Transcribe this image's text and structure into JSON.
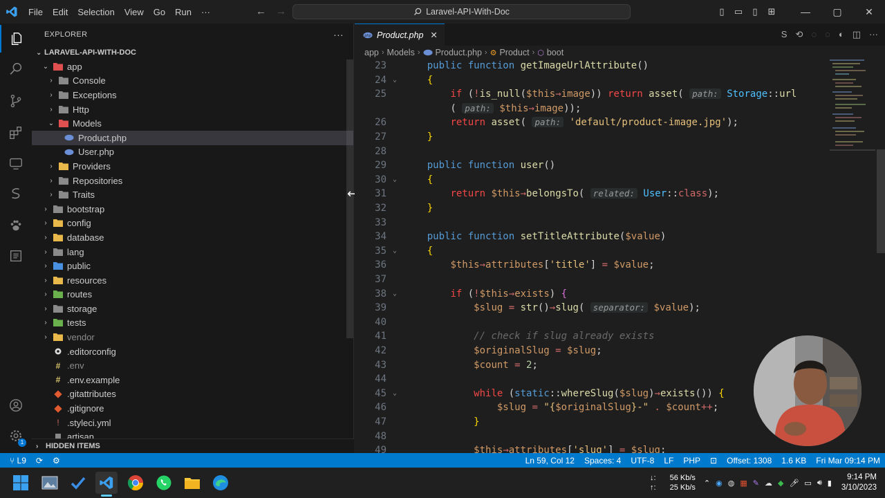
{
  "titlebar": {
    "menu": [
      "File",
      "Edit",
      "Selection",
      "View",
      "Go",
      "Run",
      "···"
    ],
    "search_text": "Laravel-API-With-Doc"
  },
  "sidebar": {
    "title": "EXPLORER",
    "more": "···",
    "project": "LARAVEL-API-WITH-DOC",
    "items": [
      {
        "label": "app",
        "chev": "⌄",
        "indent": 1,
        "icon": "folder-app-icon"
      },
      {
        "label": "Console",
        "chev": "›",
        "indent": 2,
        "icon": "folder-icon"
      },
      {
        "label": "Exceptions",
        "chev": "›",
        "indent": 2,
        "icon": "folder-icon"
      },
      {
        "label": "Http",
        "chev": "›",
        "indent": 2,
        "icon": "folder-icon"
      },
      {
        "label": "Models",
        "chev": "⌄",
        "indent": 2,
        "icon": "folder-models-icon"
      },
      {
        "label": "Product.php",
        "chev": "",
        "indent": 3,
        "icon": "php-file-icon",
        "selected": true
      },
      {
        "label": "User.php",
        "chev": "",
        "indent": 3,
        "icon": "php-file-icon"
      },
      {
        "label": "Providers",
        "chev": "›",
        "indent": 2,
        "icon": "folder-yellow-icon"
      },
      {
        "label": "Repositories",
        "chev": "›",
        "indent": 2,
        "icon": "folder-icon"
      },
      {
        "label": "Traits",
        "chev": "›",
        "indent": 2,
        "icon": "folder-icon"
      },
      {
        "label": "bootstrap",
        "chev": "›",
        "indent": 1,
        "icon": "folder-icon"
      },
      {
        "label": "config",
        "chev": "›",
        "indent": 1,
        "icon": "folder-yellow-icon"
      },
      {
        "label": "database",
        "chev": "›",
        "indent": 1,
        "icon": "folder-yellow-icon"
      },
      {
        "label": "lang",
        "chev": "›",
        "indent": 1,
        "icon": "folder-icon"
      },
      {
        "label": "public",
        "chev": "›",
        "indent": 1,
        "icon": "folder-blue-icon"
      },
      {
        "label": "resources",
        "chev": "›",
        "indent": 1,
        "icon": "folder-yellow-icon"
      },
      {
        "label": "routes",
        "chev": "›",
        "indent": 1,
        "icon": "folder-green-icon"
      },
      {
        "label": "storage",
        "chev": "›",
        "indent": 1,
        "icon": "folder-icon"
      },
      {
        "label": "tests",
        "chev": "›",
        "indent": 1,
        "icon": "folder-green-icon"
      },
      {
        "label": "vendor",
        "chev": "›",
        "indent": 1,
        "icon": "folder-yellow-icon",
        "dim": true
      },
      {
        "label": ".editorconfig",
        "chev": "",
        "indent": 1,
        "icon": "gear-file-icon"
      },
      {
        "label": ".env",
        "chev": "",
        "indent": 1,
        "icon": "hash-file-icon",
        "dim": true
      },
      {
        "label": ".env.example",
        "chev": "",
        "indent": 1,
        "icon": "hash-file-icon"
      },
      {
        "label": ".gitattributes",
        "chev": "",
        "indent": 1,
        "icon": "git-file-icon"
      },
      {
        "label": ".gitignore",
        "chev": "",
        "indent": 1,
        "icon": "git-file-icon"
      },
      {
        "label": ".styleci.yml",
        "chev": "",
        "indent": 1,
        "icon": "yml-file-icon"
      },
      {
        "label": "artisan",
        "chev": "",
        "indent": 1,
        "icon": "file-icon"
      }
    ],
    "hidden_items": "HIDDEN ITEMS"
  },
  "editor": {
    "tab_label": "Product.php",
    "breadcrumb": [
      "app",
      "Models",
      "Product.php",
      "Product",
      "boot"
    ]
  },
  "code_lines": [
    {
      "n": "23",
      "html": "<span class='k'>public</span> <span class='k'>function</span> <span class='fy'>getImageUrlAttribute</span>()"
    },
    {
      "n": "24",
      "html": "<span class='br1'>{</span>",
      "fold": true
    },
    {
      "n": "25",
      "html": "    <span class='kr'>if</span> (<span class='op'>!</span><span class='fy'>is_null</span>(<span class='v'>$this</span><span class='op'>→</span><span class='v'>image</span>)) <span class='kr'>return</span> <span class='fy'>asset</span>( <span class='hint'>path:</span> <span class='cls'>Storage</span>::<span class='fy'>url</span>"
    },
    {
      "n": "",
      "html": "    ( <span class='hint'>path:</span> <span class='v'>$this</span><span class='op'>→</span><span class='v'>image</span>));"
    },
    {
      "n": "26",
      "html": "    <span class='kr'>return</span> <span class='fy'>asset</span>( <span class='hint'>path:</span> <span class='st'>'default/product-image.jpg'</span>);"
    },
    {
      "n": "27",
      "html": "<span class='br1'>}</span>"
    },
    {
      "n": "28",
      "html": ""
    },
    {
      "n": "29",
      "html": "<span class='k'>public</span> <span class='k'>function</span> <span class='fy'>user</span>()"
    },
    {
      "n": "30",
      "html": "<span class='br1'>{</span>",
      "fold": true
    },
    {
      "n": "31",
      "html": "    <span class='kr'>return</span> <span class='v'>$this</span><span class='op'>→</span><span class='fy'>belongsTo</span>( <span class='hint'>related:</span> <span class='cls'>User</span>::<span class='op'>class</span>);"
    },
    {
      "n": "32",
      "html": "<span class='br1'>}</span>"
    },
    {
      "n": "33",
      "html": ""
    },
    {
      "n": "34",
      "html": "<span class='k'>public</span> <span class='k'>function</span> <span class='fy'>setTitleAttribute</span>(<span class='v'>$value</span>)"
    },
    {
      "n": "35",
      "html": "<span class='br1'>{</span>",
      "fold": true
    },
    {
      "n": "36",
      "html": "    <span class='v'>$this</span><span class='op'>→</span><span class='v'>attributes</span>[<span class='st'>'title'</span>] <span class='op'>=</span> <span class='v'>$value</span>;"
    },
    {
      "n": "37",
      "html": ""
    },
    {
      "n": "38",
      "html": "    <span class='kr'>if</span> (<span class='op'>!</span><span class='v'>$this</span><span class='op'>→</span><span class='v'>exists</span>) <span class='br2'>{</span>",
      "fold": true
    },
    {
      "n": "39",
      "html": "        <span class='v'>$slug</span> <span class='op'>=</span> <span class='fy'>str</span>()<span class='op'>→</span><span class='fy'>slug</span>( <span class='hint'>separator:</span> <span class='v'>$value</span>);"
    },
    {
      "n": "40",
      "html": ""
    },
    {
      "n": "41",
      "html": "        <span class='cm'>// check if slug already exists</span>"
    },
    {
      "n": "42",
      "html": "        <span class='v'>$originalSlug</span> <span class='op'>=</span> <span class='v'>$slug</span>;"
    },
    {
      "n": "43",
      "html": "        <span class='v'>$count</span> <span class='op'>=</span> <span class='num'>2</span>;"
    },
    {
      "n": "44",
      "html": ""
    },
    {
      "n": "45",
      "html": "        <span class='kr'>while</span> (<span class='k'>static</span>::<span class='fy'>whereSlug</span>(<span class='v'>$slug</span>)<span class='op'>→</span><span class='fy'>exists</span>()) <span class='br1'>{</span>",
      "fold": true
    },
    {
      "n": "46",
      "html": "            <span class='v'>$slug</span> <span class='op'>=</span> <span class='st'>\"{</span><span class='v'>$originalSlug</span><span class='st'>}-\"</span> <span class='op'>.</span> <span class='v'>$count</span><span class='op'>++</span>;"
    },
    {
      "n": "47",
      "html": "        <span class='br1'>}</span>"
    },
    {
      "n": "48",
      "html": ""
    },
    {
      "n": "49",
      "html": "        <span class='v'>$this</span><span class='op'>→</span><span class='v'>attributes</span>[<span class='st'>'slug'</span>] <span class='op'>=</span> <span class='v'>$slug</span>;"
    }
  ],
  "statusbar": {
    "branch": "L9",
    "position": "Ln 59, Col 12",
    "spaces": "Spaces: 4",
    "encoding": "UTF-8",
    "eol": "LF",
    "language": "PHP",
    "offset": "Offset: 1308",
    "size": "1.6 KB",
    "datetime": "Fri Mar 09:14 PM"
  },
  "taskbar": {
    "net_down": "56 Kb/s",
    "net_up": "25 Kb/s",
    "time": "9:14 PM",
    "date": "3/10/2023"
  },
  "colors": {
    "accent": "#007acc",
    "tab_border": "#0078d4"
  }
}
